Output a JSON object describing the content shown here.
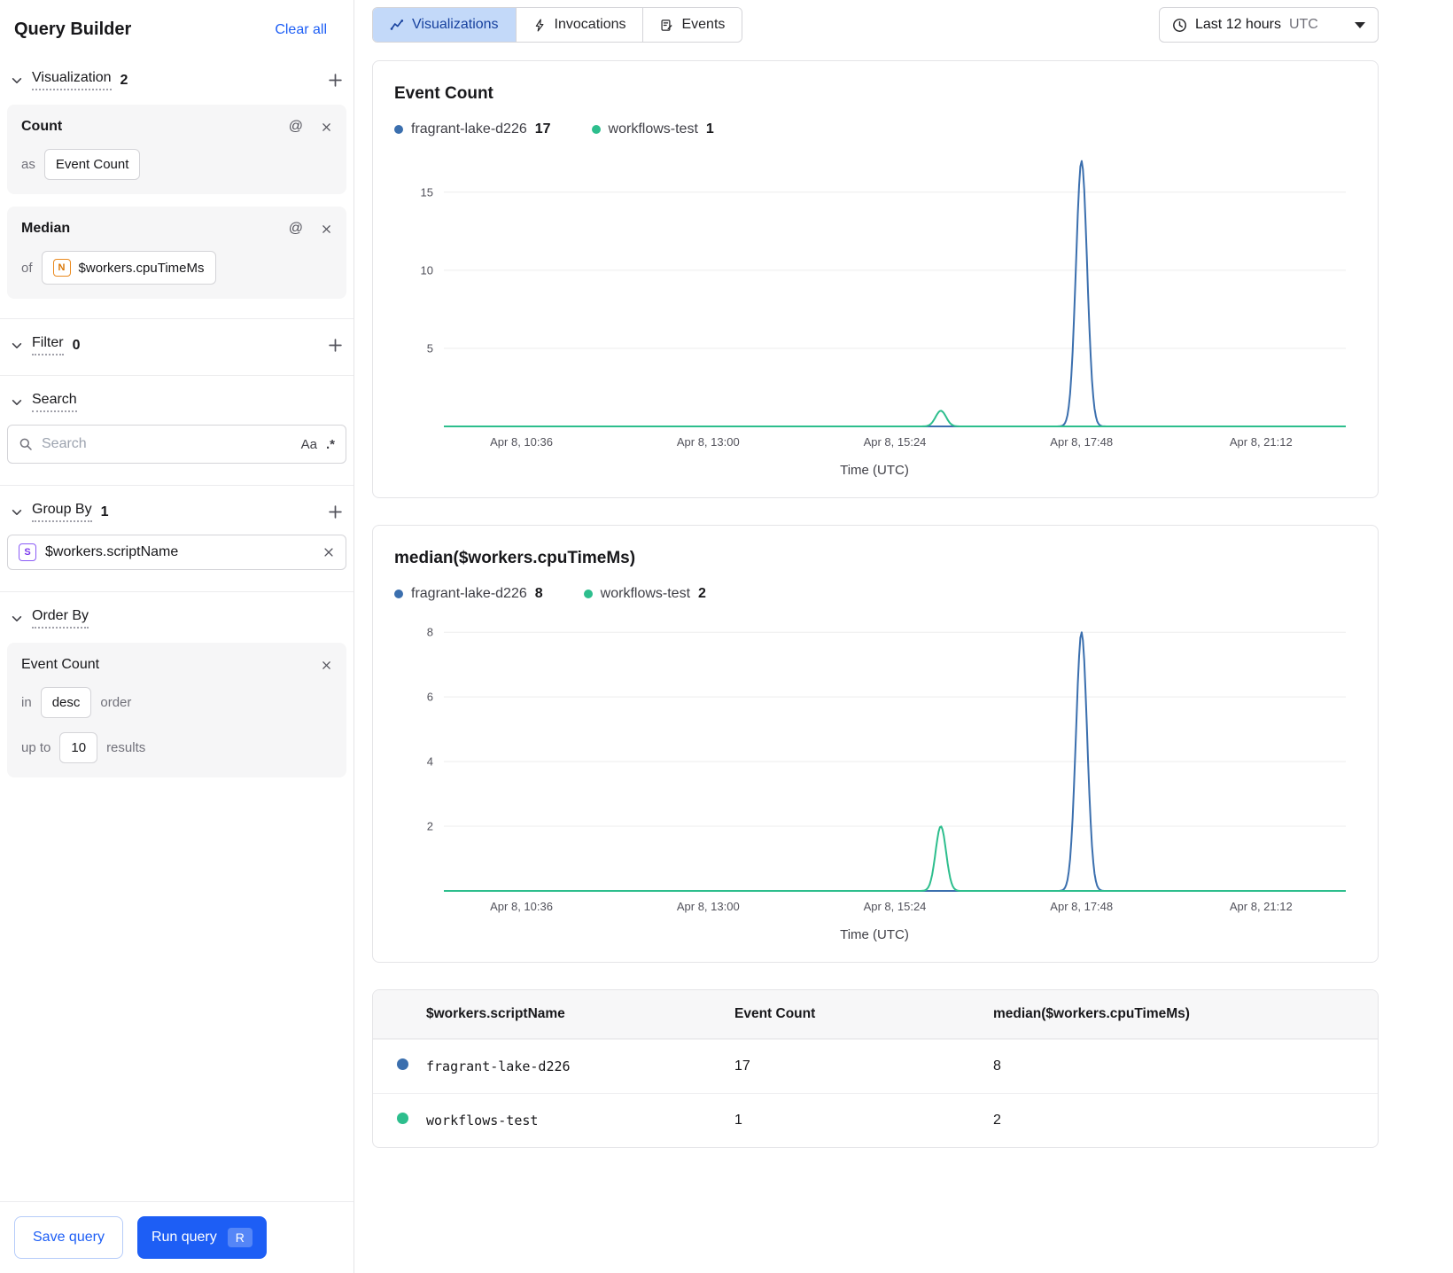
{
  "colors": {
    "accent": "#1d5ef5",
    "tab_active_bg": "#c3d9f9",
    "tab_active_text": "#17419e",
    "series_blue": "#3b6fae",
    "series_green": "#2dbe8d"
  },
  "sidebar": {
    "title": "Query Builder",
    "clear_all": "Clear all",
    "sections": {
      "visualization": {
        "label": "Visualization",
        "count": "2"
      },
      "filter": {
        "label": "Filter",
        "count": "0"
      },
      "search": {
        "label": "Search"
      },
      "group_by": {
        "label": "Group By",
        "count": "1"
      },
      "order_by": {
        "label": "Order By"
      }
    },
    "cards": {
      "count": {
        "title": "Count",
        "as_label": "as",
        "value": "Event Count"
      },
      "median": {
        "title": "Median",
        "of_label": "of",
        "icon": "N",
        "field": "$workers.cpuTimeMs"
      }
    },
    "search": {
      "placeholder": "Search",
      "case_toggle": "Aa",
      "regex_toggle": ".*"
    },
    "group_by_item": {
      "icon": "S",
      "label": "$workers.scriptName"
    },
    "order_by": {
      "title": "Event Count",
      "in_label": "in",
      "direction": "desc",
      "order_label": "order",
      "upto_label": "up to",
      "limit": "10",
      "results_label": "results"
    },
    "footer": {
      "save": "Save query",
      "run": "Run query",
      "shortcut": "R"
    }
  },
  "header": {
    "tabs": [
      {
        "label": "Visualizations",
        "active": true
      },
      {
        "label": "Invocations",
        "active": false
      },
      {
        "label": "Events",
        "active": false
      }
    ],
    "time": {
      "label": "Last 12 hours",
      "tz": "UTC"
    }
  },
  "chart_data": [
    {
      "type": "line",
      "title": "Event Count",
      "xlabel": "Time (UTC)",
      "x_ticks": [
        "Apr 8, 10:36",
        "Apr 8, 13:00",
        "Apr 8, 15:24",
        "Apr 8, 17:48",
        "Apr 8, 21:12"
      ],
      "tick_fracs": [
        0.086,
        0.293,
        0.5,
        0.707,
        0.906
      ],
      "y_ticks": [
        5,
        10,
        15
      ],
      "ylim": [
        0,
        17.6
      ],
      "legend": [
        {
          "name": "fragrant-lake-d226",
          "value": "17",
          "color": "#3b6fae"
        },
        {
          "name": "workflows-test",
          "value": "1",
          "color": "#2dbe8d"
        }
      ],
      "series": [
        {
          "name": "fragrant-lake-d226",
          "color": "#3b6fae",
          "peak": {
            "center": 0.707,
            "sigma": 0.0062,
            "height": 17
          }
        },
        {
          "name": "workflows-test",
          "color": "#2dbe8d",
          "peak": {
            "center": 0.551,
            "sigma": 0.0058,
            "height": 1
          }
        }
      ]
    },
    {
      "type": "line",
      "title": "median($workers.cpuTimeMs)",
      "xlabel": "Time (UTC)",
      "x_ticks": [
        "Apr 8, 10:36",
        "Apr 8, 13:00",
        "Apr 8, 15:24",
        "Apr 8, 17:48",
        "Apr 8, 21:12"
      ],
      "tick_fracs": [
        0.086,
        0.293,
        0.5,
        0.707,
        0.906
      ],
      "y_ticks": [
        2,
        4,
        6,
        8
      ],
      "ylim": [
        0,
        8.5
      ],
      "legend": [
        {
          "name": "fragrant-lake-d226",
          "value": "8",
          "color": "#3b6fae"
        },
        {
          "name": "workflows-test",
          "value": "2",
          "color": "#2dbe8d"
        }
      ],
      "series": [
        {
          "name": "fragrant-lake-d226",
          "color": "#3b6fae",
          "peak": {
            "center": 0.707,
            "sigma": 0.0062,
            "height": 8
          }
        },
        {
          "name": "workflows-test",
          "color": "#2dbe8d",
          "peak": {
            "center": 0.551,
            "sigma": 0.0058,
            "height": 2
          }
        }
      ]
    }
  ],
  "table": {
    "columns": [
      "$workers.scriptName",
      "Event Count",
      "median($workers.cpuTimeMs)"
    ],
    "rows": [
      {
        "color": "#3b6fae",
        "name": "fragrant-lake-d226",
        "event_count": "17",
        "median": "8"
      },
      {
        "color": "#2dbe8d",
        "name": "workflows-test",
        "event_count": "1",
        "median": "2"
      }
    ]
  }
}
